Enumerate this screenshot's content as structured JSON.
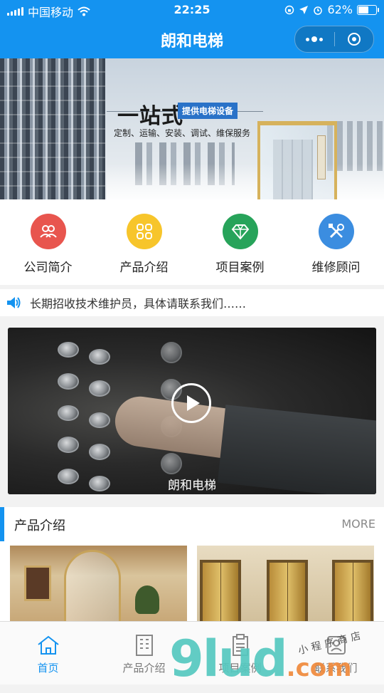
{
  "status_bar": {
    "carrier": "中国移动",
    "time": "22:25",
    "battery": "62%",
    "battery_level": 0.62
  },
  "nav": {
    "title": "朗和电梯"
  },
  "banner": {
    "headline": "一站式",
    "tag": "提供电梯设备",
    "services": "定制、运输、安装、调试、维保服务",
    "page_count": 1,
    "current_page": 1
  },
  "quick_menu": [
    {
      "label": "公司简介",
      "icon": "people-icon",
      "color": "#e8554e"
    },
    {
      "label": "产品介绍",
      "icon": "grid-icon",
      "color": "#f7c52b"
    },
    {
      "label": "项目案例",
      "icon": "diamond-icon",
      "color": "#27a35a"
    },
    {
      "label": "维修顾问",
      "icon": "tools-icon",
      "color": "#3b8de0"
    }
  ],
  "notice": {
    "text": "长期招收技术维护员，具体请联系我们……"
  },
  "video": {
    "caption": "朗和电梯"
  },
  "product_section": {
    "title": "产品介绍",
    "more": "MORE"
  },
  "tabbar": [
    {
      "label": "首页",
      "icon": "home-icon",
      "active": true
    },
    {
      "label": "产品介绍",
      "icon": "building-icon",
      "active": false
    },
    {
      "label": "项目案例",
      "icon": "clipboard-icon",
      "active": false
    },
    {
      "label": "联系我们",
      "icon": "contact-icon",
      "active": false
    }
  ],
  "watermark": {
    "brand": "9lud",
    "suffix": ".com",
    "handwriting": "小程序商店"
  },
  "colors": {
    "accent": "#1493f0"
  }
}
